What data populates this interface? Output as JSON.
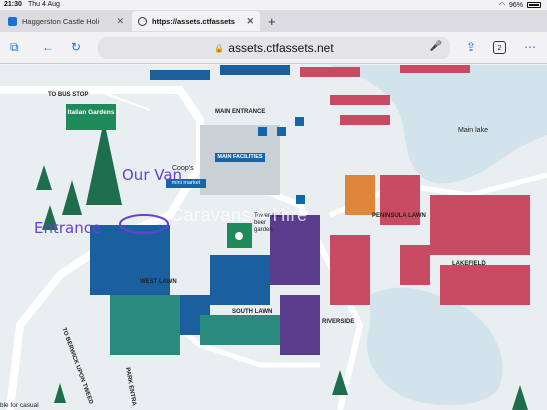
{
  "status_bar": {
    "time": "21:30",
    "date": "Thu 4 Aug",
    "battery": "96%"
  },
  "tabs": [
    {
      "label": "Haggerston Castle Holi",
      "active": false
    },
    {
      "label": "https://assets.ctfassets",
      "active": true
    }
  ],
  "toolbar": {
    "url": "assets.ctfassets.net",
    "tab_count": "2"
  },
  "map": {
    "labels": {
      "bus_stop": "TO BUS STOP",
      "italian_gardens": "Italian Gardens",
      "main_entrance": "MAIN ENTRANCE",
      "main_facilities": "MAIN FACILITIES",
      "mini_market": "mini market",
      "coops": "Coop's",
      "main_lake": "Main lake",
      "peninsula_lawn": "PENINSULA LAWN",
      "lakefield": "LAKEFIELD",
      "west_lawn": "WEST LAWN",
      "south_lawn": "SOUTH LAWN",
      "riverside": "RIVERSIDE",
      "tower_garden": "Tower and beer garden",
      "to_berwick": "TO BERWICK UPON TWEED",
      "park_entrance": "PARK ENTRA",
      "bottom_text": "ble for casual"
    },
    "watermark": "Caravans 4 Hire",
    "handwriting": {
      "our_van": "Our Van",
      "entrance": "Entrance"
    },
    "colors": {
      "lake": "#d3e3ec",
      "grass": "#e9eef1",
      "blue_plot": "#1a5f9e",
      "pink_plot": "#c84a63",
      "orange_plot": "#e0863a",
      "purple_plot": "#5a3c8c",
      "teal_plot": "#2a8a7e",
      "tree": "#1e6e4e",
      "annotation": "#6a3fd6"
    }
  }
}
